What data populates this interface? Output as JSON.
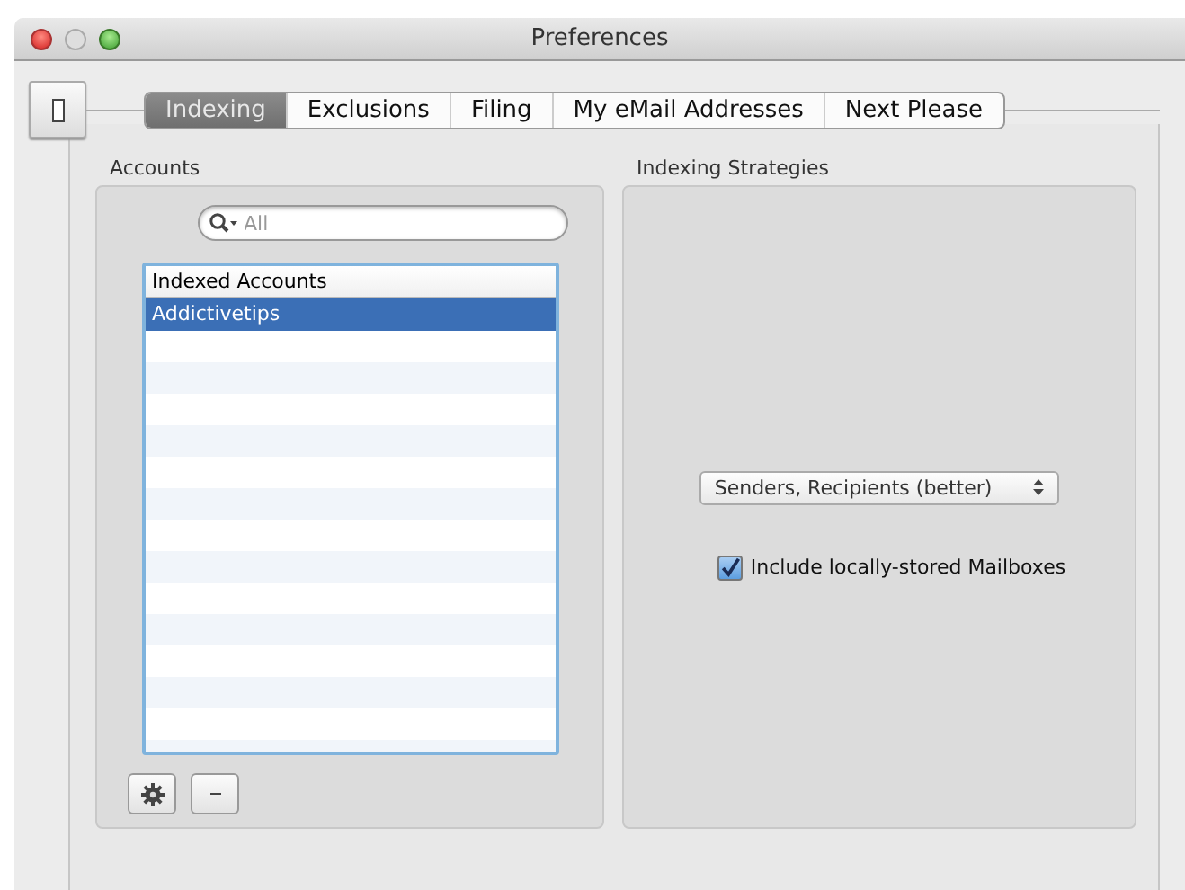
{
  "window": {
    "title": "Preferences"
  },
  "tabs": [
    {
      "label": "Indexing",
      "selected": true
    },
    {
      "label": "Exclusions",
      "selected": false
    },
    {
      "label": "Filing",
      "selected": false
    },
    {
      "label": "My eMail Addresses",
      "selected": false
    },
    {
      "label": "Next Please",
      "selected": false
    }
  ],
  "accounts": {
    "title": "Accounts",
    "search": {
      "placeholder": "All"
    },
    "list_header": "Indexed Accounts",
    "items": [
      {
        "label": "Addictivetips",
        "selected": true
      }
    ]
  },
  "strategies": {
    "title": "Indexing Strategies",
    "popup": "Senders, Recipients (better)",
    "checkbox": {
      "label": "Include locally-stored Mailboxes",
      "checked": true
    }
  }
}
